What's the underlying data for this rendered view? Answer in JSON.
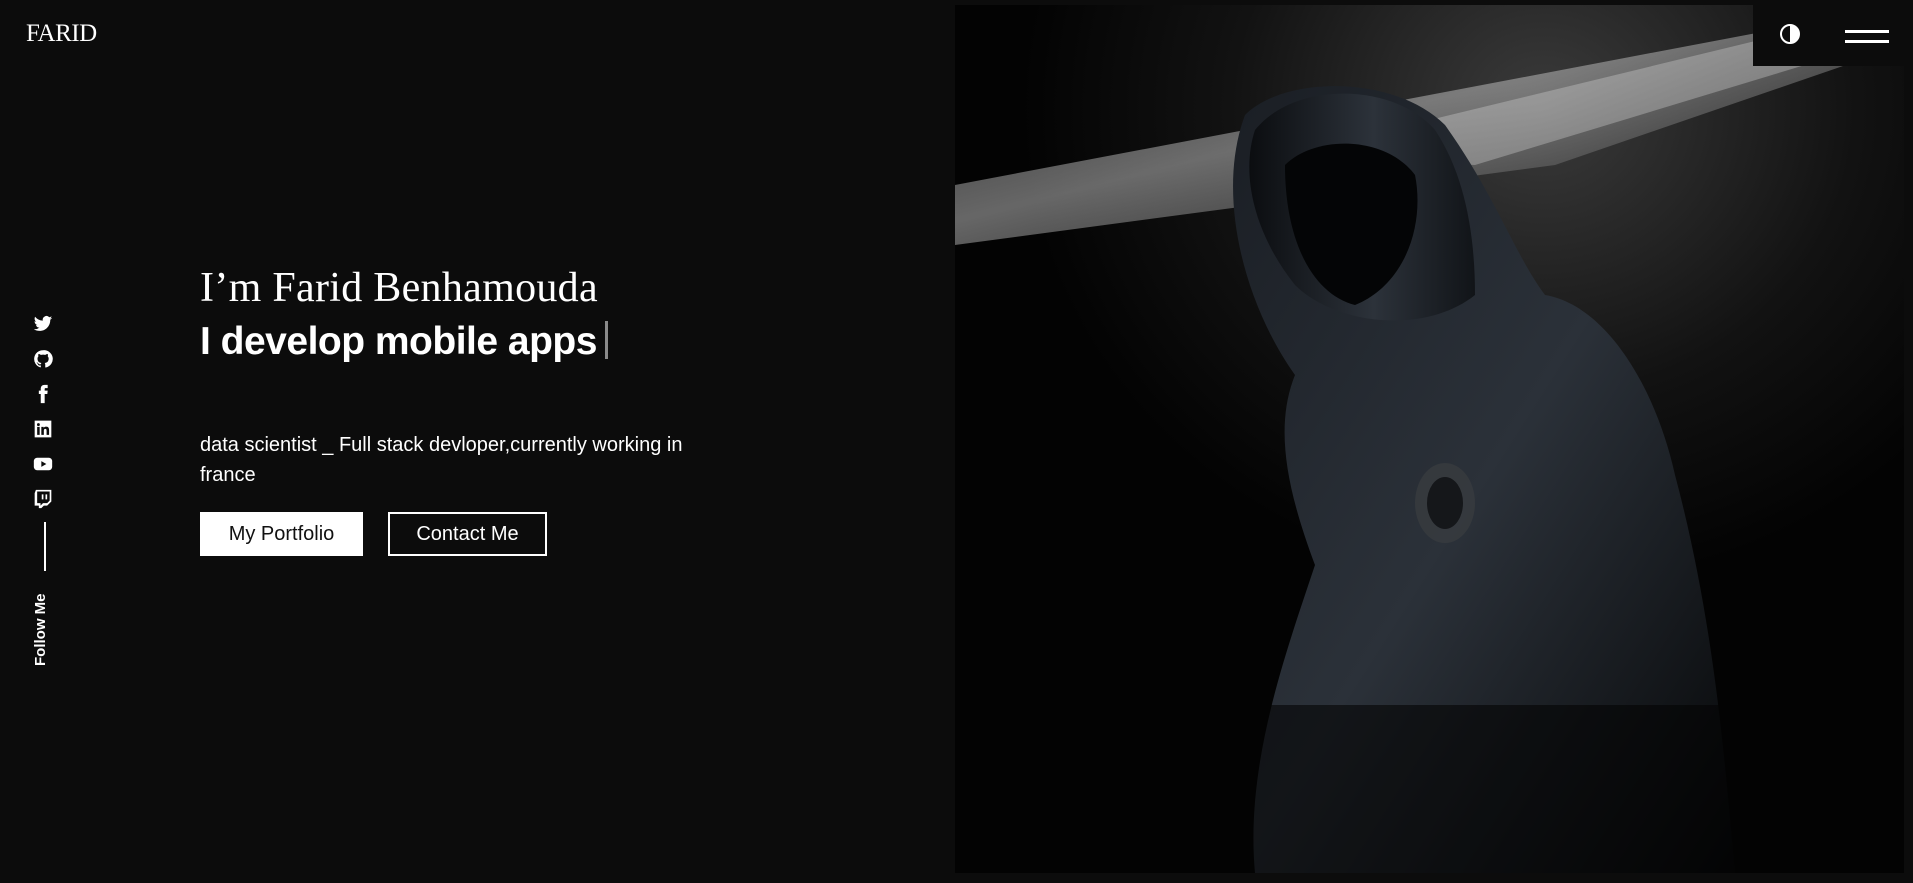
{
  "header": {
    "logo": "FARID",
    "theme_icon": "contrast-icon",
    "menu_icon": "hamburger-menu-icon"
  },
  "social": {
    "items": [
      {
        "name": "twitter",
        "icon": "twitter-icon"
      },
      {
        "name": "github",
        "icon": "github-icon"
      },
      {
        "name": "facebook",
        "icon": "facebook-icon"
      },
      {
        "name": "linkedin",
        "icon": "linkedin-icon"
      },
      {
        "name": "youtube",
        "icon": "youtube-icon"
      },
      {
        "name": "twitch",
        "icon": "twitch-icon"
      }
    ],
    "follow_label": "Follow Me"
  },
  "hero": {
    "greeting": "I’m Farid Benhamouda",
    "headline": "I develop mobile apps",
    "bio": "data scientist _ Full stack devloper,currently working in france",
    "portfolio_label": "My Portfolio",
    "contact_label": "Contact Me"
  },
  "colors": {
    "background": "#0c0c0c",
    "text": "#ffffff",
    "cursor": "#8a8a8a"
  }
}
